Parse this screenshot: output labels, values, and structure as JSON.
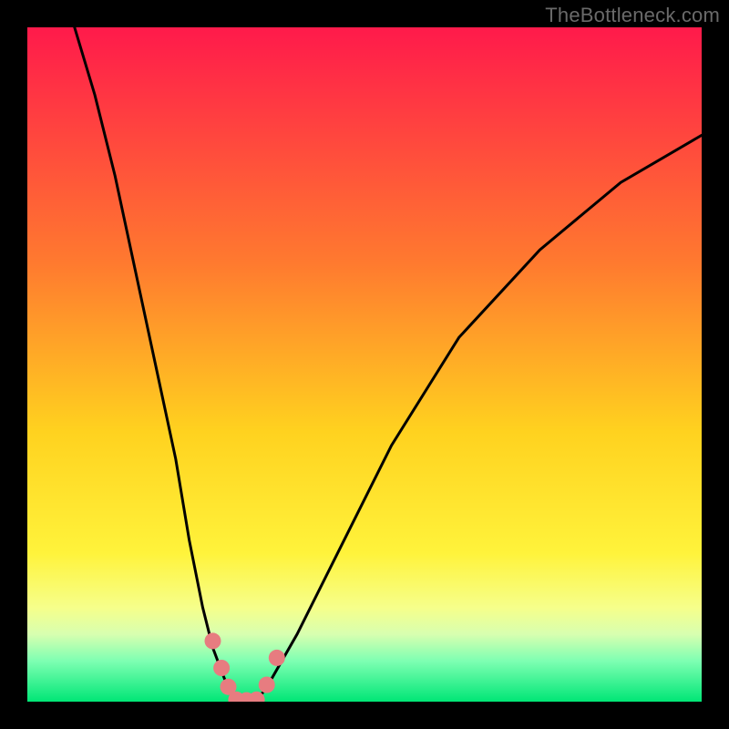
{
  "watermark": "TheBottleneck.com",
  "chart_data": {
    "type": "line",
    "title": "",
    "xlabel": "",
    "ylabel": "",
    "xlim": [
      0,
      100
    ],
    "ylim": [
      0,
      100
    ],
    "grid": false,
    "legend": false,
    "gradient_stops": [
      {
        "offset": 0,
        "color": "#ff1a4b"
      },
      {
        "offset": 35,
        "color": "#ff7a2f"
      },
      {
        "offset": 60,
        "color": "#ffd21f"
      },
      {
        "offset": 78,
        "color": "#fff33b"
      },
      {
        "offset": 86,
        "color": "#f6ff8a"
      },
      {
        "offset": 90,
        "color": "#d8ffb0"
      },
      {
        "offset": 94,
        "color": "#7dffb2"
      },
      {
        "offset": 100,
        "color": "#00e676"
      }
    ],
    "series": [
      {
        "name": "left-branch",
        "color": "#000000",
        "x": [
          7,
          10,
          13,
          16,
          19,
          22,
          24,
          26,
          27.5,
          29,
          30,
          31
        ],
        "y": [
          100,
          90,
          78,
          64,
          50,
          36,
          24,
          14,
          8,
          4,
          1.5,
          0
        ]
      },
      {
        "name": "right-branch",
        "color": "#000000",
        "x": [
          34,
          36,
          40,
          46,
          54,
          64,
          76,
          88,
          100
        ],
        "y": [
          0,
          3,
          10,
          22,
          38,
          54,
          67,
          77,
          84
        ]
      },
      {
        "name": "floor",
        "color": "#000000",
        "x": [
          31,
          34
        ],
        "y": [
          0,
          0
        ]
      }
    ],
    "markers": {
      "name": "highlight-dots",
      "color": "#e77c80",
      "radius_px": 9,
      "points": [
        {
          "x": 27.5,
          "y": 9
        },
        {
          "x": 28.8,
          "y": 5
        },
        {
          "x": 29.8,
          "y": 2.2
        },
        {
          "x": 31,
          "y": 0.3
        },
        {
          "x": 32.5,
          "y": 0.2
        },
        {
          "x": 34,
          "y": 0.3
        },
        {
          "x": 35.5,
          "y": 2.5
        },
        {
          "x": 37,
          "y": 6.5
        }
      ]
    }
  }
}
